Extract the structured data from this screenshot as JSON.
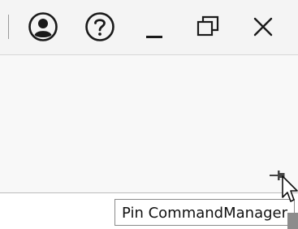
{
  "window_controls": {
    "user_icon": "user-account-icon",
    "help_icon": "help-icon",
    "minimize_icon": "minimize-icon",
    "restore_icon": "restore-icon",
    "close_icon": "close-icon"
  },
  "command_manager": {
    "pin_icon": "pin-icon"
  },
  "tooltip": {
    "text": "Pin CommandManager"
  },
  "colors": {
    "titlebar_bg": "#f4f4f4",
    "panel_bg": "#f8f8f8",
    "icon_color": "#1a1a1a"
  }
}
